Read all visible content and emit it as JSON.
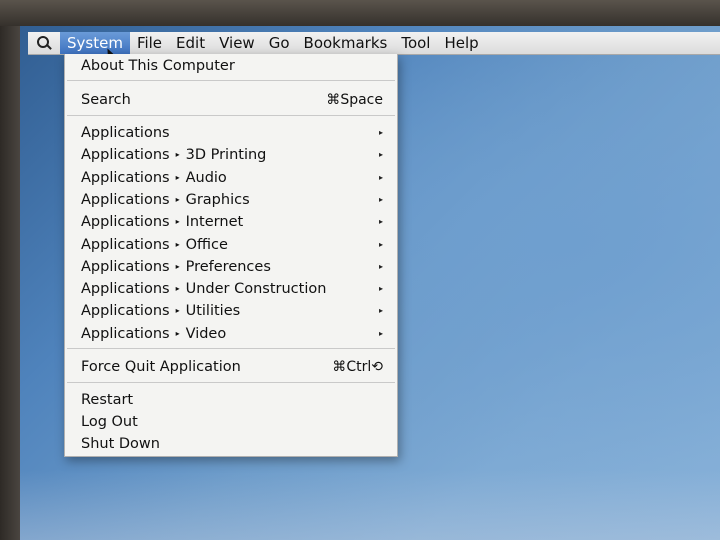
{
  "menubar": {
    "items": [
      {
        "label": "System",
        "active": true
      },
      {
        "label": "File"
      },
      {
        "label": "Edit"
      },
      {
        "label": "View"
      },
      {
        "label": "Go"
      },
      {
        "label": "Bookmarks"
      },
      {
        "label": "Tool"
      },
      {
        "label": "Help"
      }
    ]
  },
  "menu": {
    "about": "About This Computer",
    "search": {
      "label": "Search",
      "shortcut": "⌘Space"
    },
    "applications": [
      {
        "label": "Applications",
        "sub": ""
      },
      {
        "label": "Applications",
        "sub": "3D Printing"
      },
      {
        "label": "Applications",
        "sub": "Audio"
      },
      {
        "label": "Applications",
        "sub": "Graphics"
      },
      {
        "label": "Applications",
        "sub": "Internet"
      },
      {
        "label": "Applications",
        "sub": "Office"
      },
      {
        "label": "Applications",
        "sub": "Preferences"
      },
      {
        "label": "Applications",
        "sub": "Under Construction"
      },
      {
        "label": "Applications",
        "sub": "Utilities"
      },
      {
        "label": "Applications",
        "sub": "Video"
      }
    ],
    "force_quit": {
      "label": "Force Quit Application",
      "shortcut": "⌘Ctrl⟲"
    },
    "restart": "Restart",
    "log_out": "Log Out",
    "shut_down": "Shut Down"
  },
  "icons": {
    "submenu_arrow": "▸",
    "search": "search-icon"
  }
}
